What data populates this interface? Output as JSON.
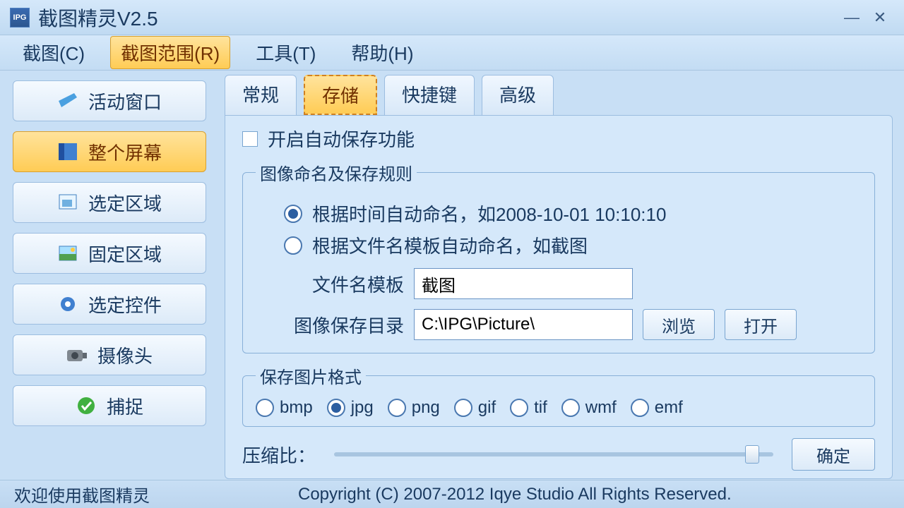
{
  "window": {
    "title": "截图精灵V2.5"
  },
  "menu": {
    "capture": "截图(C)",
    "range": "截图范围(R)",
    "tools": "工具(T)",
    "help": "帮助(H)"
  },
  "sidebar": {
    "active_window": "活动窗口",
    "full_screen": "整个屏幕",
    "select_area": "选定区域",
    "fixed_area": "固定区域",
    "select_control": "选定控件",
    "camera": "摄像头",
    "capture": "捕捉"
  },
  "tabs": {
    "general": "常规",
    "storage": "存储",
    "hotkey": "快捷键",
    "advanced": "高级"
  },
  "storage": {
    "auto_save": "开启自动保存功能",
    "naming_legend": "图像命名及保存规则",
    "by_time": "根据时间自动命名，如2008-10-01 10:10:10",
    "by_template": "根据文件名模板自动命名，如截图",
    "template_label": "文件名模板",
    "template_value": "截图",
    "dir_label": "图像保存目录",
    "dir_value": "C:\\IPG\\Picture\\",
    "browse": "浏览",
    "open": "打开",
    "format_legend": "保存图片格式",
    "formats": {
      "bmp": "bmp",
      "jpg": "jpg",
      "png": "png",
      "gif": "gif",
      "tif": "tif",
      "wmf": "wmf",
      "emf": "emf"
    },
    "ratio_label": "压缩比：",
    "ok": "确定"
  },
  "status": {
    "welcome": "欢迎使用截图精灵",
    "copyright": "Copyright (C) 2007-2012 Iqye Studio All Rights Reserved."
  }
}
